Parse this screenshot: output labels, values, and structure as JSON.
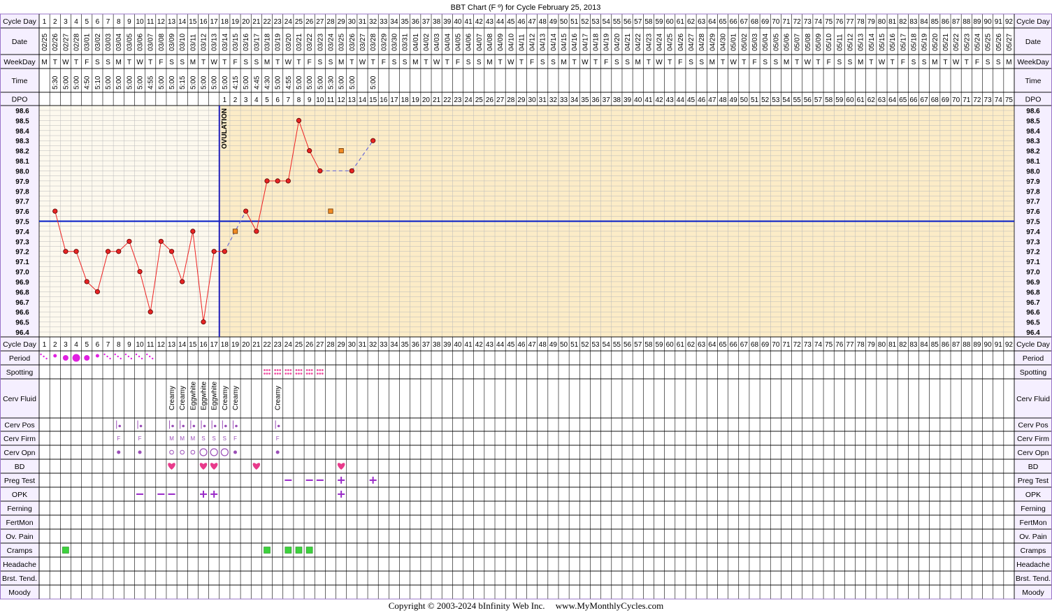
{
  "title": "BBT Chart (F º) for Cycle February 25, 2013",
  "row_labels": {
    "cycle_day": "Cycle Day",
    "date": "Date",
    "weekday": "WeekDay",
    "time": "Time",
    "dpo": "DPO",
    "period": "Period",
    "spotting": "Spotting",
    "cerv_fluid": "Cerv Fluid",
    "cerv_pos": "Cerv Pos",
    "cerv_firm": "Cerv Firm",
    "cerv_opn": "Cerv Opn",
    "bd": "BD",
    "preg_test": "Preg Test",
    "opk": "OPK",
    "ferning": "Ferning",
    "fertmon": "FertMon",
    "ov_pain": "Ov. Pain",
    "cramps": "Cramps",
    "headache": "Headache",
    "brst_tend": "Brst. Tend.",
    "moody": "Moody"
  },
  "ovulation_label": "OVULATION",
  "colors": {
    "pre_ovulation_bg": "#fdf9ee",
    "post_ovulation_bg": "#fcecc7",
    "grid": "#b9b9b9",
    "label_bg": "#f5efff",
    "frame": "#9a74c9",
    "temp_line": "#ee2222",
    "dot_fill": "#e62424",
    "coverline": "#0019c7",
    "ovulation_line": "#2020bb",
    "interpolated_line": "#6b6bd6",
    "discarded_point": "#f08a25",
    "period": "#e020e0",
    "spotting": "#ee4fa0",
    "cerv_marks": "#9a4fb7",
    "heart": "#e83a8b",
    "test_mark": "#9a2cc8",
    "cramps": "#3dd23d"
  },
  "cycle_days": [
    1,
    2,
    3,
    4,
    5,
    6,
    7,
    8,
    9,
    10,
    11,
    12,
    13,
    14,
    15,
    16,
    17,
    18,
    19,
    20,
    21,
    22,
    23,
    24,
    25,
    26,
    27,
    28,
    29,
    30,
    31,
    32,
    33,
    34,
    35,
    36,
    37,
    38,
    39,
    40,
    41,
    42,
    43,
    44,
    45,
    46,
    47,
    48,
    49,
    50,
    51,
    52,
    53,
    54,
    55,
    56,
    57,
    58,
    59,
    60,
    61,
    62,
    63,
    64,
    65,
    66,
    67,
    68,
    69,
    70,
    71,
    72,
    73,
    74,
    75,
    76,
    77,
    78,
    79,
    80,
    81,
    82,
    83,
    84,
    85,
    86,
    87,
    88,
    89,
    90,
    91,
    92
  ],
  "dates": [
    "02/25",
    "02/26",
    "02/27",
    "02/28",
    "03/01",
    "03/02",
    "03/03",
    "03/04",
    "03/05",
    "03/06",
    "03/07",
    "03/08",
    "03/09",
    "03/10",
    "03/11",
    "03/12",
    "03/13",
    "03/14",
    "03/15",
    "03/16",
    "03/17",
    "03/18",
    "03/19",
    "03/20",
    "03/21",
    "03/22",
    "03/23",
    "03/24",
    "03/25",
    "03/26",
    "03/27",
    "03/28",
    "03/29",
    "03/30",
    "03/31",
    "04/01",
    "04/02",
    "04/03",
    "04/04",
    "04/05",
    "04/06",
    "04/07",
    "04/08",
    "04/09",
    "04/10",
    "04/11",
    "04/12",
    "04/13",
    "04/14",
    "04/15",
    "04/16",
    "04/17",
    "04/18",
    "04/19",
    "04/20",
    "04/21",
    "04/22",
    "04/23",
    "04/24",
    "04/25",
    "04/26",
    "04/27",
    "04/28",
    "04/29",
    "04/30",
    "05/01",
    "05/02",
    "05/03",
    "05/04",
    "05/05",
    "05/06",
    "05/07",
    "05/08",
    "05/09",
    "05/10",
    "05/11",
    "05/12",
    "05/13",
    "05/14",
    "05/15",
    "05/16",
    "05/17",
    "05/18",
    "05/19",
    "05/20",
    "05/21",
    "05/22",
    "05/23",
    "05/24",
    "05/25",
    "05/26",
    "05/27"
  ],
  "weekdays": [
    "M",
    "T",
    "W",
    "T",
    "F",
    "S",
    "S",
    "M",
    "T",
    "W",
    "T",
    "F",
    "S",
    "S",
    "M",
    "T",
    "W",
    "T",
    "F",
    "S",
    "S",
    "M",
    "T",
    "W",
    "T",
    "F",
    "S",
    "S",
    "M",
    "T",
    "W",
    "T",
    "F",
    "S",
    "S",
    "M",
    "T",
    "W",
    "T",
    "F",
    "S",
    "S",
    "M",
    "T",
    "W",
    "T",
    "F",
    "S",
    "S",
    "M",
    "T",
    "W",
    "T",
    "F",
    "S",
    "S",
    "M",
    "T",
    "W",
    "T",
    "F",
    "S",
    "S",
    "M",
    "T",
    "W",
    "T",
    "F",
    "S",
    "S",
    "M",
    "T",
    "W",
    "T",
    "F",
    "S",
    "S",
    "M",
    "T",
    "W",
    "T",
    "F",
    "S",
    "S",
    "M",
    "T",
    "W",
    "T",
    "F",
    "S",
    "S",
    "M"
  ],
  "times": [
    "",
    "5:30",
    "5:00",
    "5:00",
    "4:50",
    "5:10",
    "5:00",
    "5:00",
    "5:00",
    "5:00",
    "4:55",
    "5:00",
    "5:00",
    "5:15",
    "5:00",
    "5:00",
    "5:00",
    "5:00",
    "4:15",
    "5:00",
    "4:45",
    "4:30",
    "5:00",
    "4:55",
    "5:00",
    "5:00",
    "5:00",
    "5:30",
    "5:00",
    "5:00",
    "",
    "5:00"
  ],
  "dpo_values": [
    1,
    2,
    3,
    4,
    5,
    6,
    7,
    8,
    9,
    10,
    11,
    12,
    13,
    14,
    15,
    16,
    17,
    18,
    19,
    20,
    21,
    22,
    23,
    24,
    25,
    26,
    27,
    28,
    29,
    30,
    31,
    32,
    33,
    34,
    35,
    36,
    37,
    38,
    39,
    40,
    41,
    42,
    43,
    44,
    45,
    46,
    47,
    48,
    49,
    50,
    51,
    52,
    53,
    54,
    55,
    56,
    57,
    58,
    59,
    60,
    61,
    62,
    63,
    64,
    65,
    66,
    67,
    68,
    69,
    70,
    71,
    72,
    73,
    74,
    75
  ],
  "dpo_start_day": 18,
  "cramps_days": [
    3,
    22,
    24,
    25,
    26
  ],
  "cerv_fluid": [
    {
      "day": 13,
      "text": "Creamy"
    },
    {
      "day": 14,
      "text": "Creamy"
    },
    {
      "day": 15,
      "text": "Eggwhite"
    },
    {
      "day": 16,
      "text": "Eggwhite"
    },
    {
      "day": 17,
      "text": "Eggwhite"
    },
    {
      "day": 18,
      "text": "Creamy"
    },
    {
      "day": 19,
      "text": "Creamy"
    },
    {
      "day": 23,
      "text": "Creamy"
    }
  ],
  "cerv_firm": [
    {
      "day": 8,
      "text": "F"
    },
    {
      "day": 10,
      "text": "F"
    },
    {
      "day": 13,
      "text": "M"
    },
    {
      "day": 14,
      "text": "M"
    },
    {
      "day": 15,
      "text": "M"
    },
    {
      "day": 16,
      "text": "S"
    },
    {
      "day": 17,
      "text": "S"
    },
    {
      "day": 18,
      "text": "S"
    },
    {
      "day": 19,
      "text": "F"
    },
    {
      "day": 23,
      "text": "F"
    }
  ],
  "cerv_pos_days": [
    8,
    10,
    13,
    14,
    15,
    16,
    17,
    18,
    19,
    23
  ],
  "cerv_opn": [
    {
      "day": 8,
      "size": "closed"
    },
    {
      "day": 10,
      "size": "closed"
    },
    {
      "day": 13,
      "size": "small"
    },
    {
      "day": 14,
      "size": "small"
    },
    {
      "day": 15,
      "size": "small"
    },
    {
      "day": 16,
      "size": "large"
    },
    {
      "day": 17,
      "size": "large"
    },
    {
      "day": 18,
      "size": "large"
    },
    {
      "day": 19,
      "size": "closed"
    },
    {
      "day": 23,
      "size": "closed"
    }
  ],
  "period": [
    {
      "day": 1,
      "level": "spotting"
    },
    {
      "day": 2,
      "level": "light"
    },
    {
      "day": 3,
      "level": "medium"
    },
    {
      "day": 4,
      "level": "heavy"
    },
    {
      "day": 5,
      "level": "medium"
    },
    {
      "day": 6,
      "level": "light"
    },
    {
      "day": 7,
      "level": "spotting"
    },
    {
      "day": 8,
      "level": "spotting"
    },
    {
      "day": 9,
      "level": "spotting"
    },
    {
      "day": 10,
      "level": "spotting"
    },
    {
      "day": 11,
      "level": "spotting"
    }
  ],
  "spotting_days": [
    22,
    23,
    24,
    25,
    26,
    27
  ],
  "bd_days": [
    13,
    16,
    17,
    21,
    29
  ],
  "preg_test": [
    {
      "day": 24,
      "result": "-"
    },
    {
      "day": 26,
      "result": "-"
    },
    {
      "day": 27,
      "result": "-"
    },
    {
      "day": 29,
      "result": "+"
    },
    {
      "day": 32,
      "result": "+"
    }
  ],
  "opk": [
    {
      "day": 10,
      "result": "-"
    },
    {
      "day": 12,
      "result": "-"
    },
    {
      "day": 13,
      "result": "-"
    },
    {
      "day": 16,
      "result": "+"
    },
    {
      "day": 17,
      "result": "+"
    },
    {
      "day": 29,
      "result": "+"
    }
  ],
  "copyright": "Copyright © 2003-2024 bInfinity Web Inc.",
  "site": "www.MyMonthlyCycles.com",
  "chart_data": {
    "type": "line",
    "title": "BBT Chart (F º) for Cycle February 25, 2013",
    "x_label": "Cycle Day",
    "ylim": [
      96.4,
      98.6
    ],
    "y_ticks": [
      "98.6",
      "98.5",
      "98.4",
      "98.3",
      "98.2",
      "98.1",
      "98.0",
      "97.9",
      "97.8",
      "97.7",
      "97.6",
      "97.5",
      "97.4",
      "97.3",
      "97.2",
      "97.1",
      "97.0",
      "96.9",
      "96.8",
      "96.7",
      "96.6",
      "96.5",
      "96.4"
    ],
    "coverline": 97.5,
    "ovulation_day": 17,
    "grid": true,
    "series": [
      {
        "x": [
          2,
          3,
          4,
          5,
          6,
          7,
          8,
          9,
          10,
          11,
          12,
          13,
          14,
          15,
          16,
          17,
          18,
          20,
          21,
          22,
          23,
          24,
          25,
          26,
          27,
          30,
          32
        ],
        "values": [
          97.6,
          97.2,
          97.2,
          96.9,
          96.8,
          97.2,
          97.2,
          97.3,
          97.0,
          96.6,
          97.3,
          97.2,
          96.9,
          97.4,
          96.5,
          97.2,
          97.2,
          97.6,
          97.4,
          97.9,
          97.9,
          97.9,
          98.5,
          98.2,
          98.0,
          98.0,
          98.3
        ]
      }
    ],
    "interpolated": [
      {
        "from": [
          18,
          97.2
        ],
        "to": [
          20,
          97.6
        ]
      },
      {
        "from": [
          27,
          98.0
        ],
        "to": [
          30,
          98.0
        ]
      },
      {
        "from": [
          30,
          98.0
        ],
        "to": [
          32,
          98.3
        ]
      }
    ],
    "discarded_points": [
      {
        "x": 19,
        "y": 97.4
      },
      {
        "x": 28,
        "y": 97.6
      },
      {
        "x": 29,
        "y": 98.2
      }
    ]
  }
}
